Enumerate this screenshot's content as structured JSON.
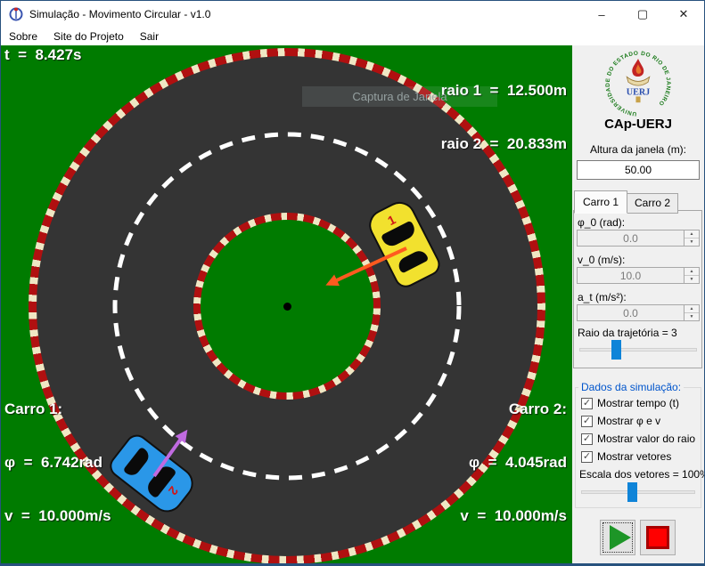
{
  "window": {
    "title": "Simulação - Movimento Circular - v1.0"
  },
  "icons": {
    "minimize": "–",
    "maximize": "▢",
    "close": "✕",
    "check": "✓",
    "spin_up": "▲",
    "spin_down": "▼"
  },
  "menu": {
    "items": [
      "Sobre",
      "Site do Projeto",
      "Sair"
    ]
  },
  "canvas": {
    "time": "t  =  8.427s",
    "radius1": "raio 1  =  12.500m",
    "radius2": "raio 2  =  20.833m",
    "capture_button": "Captura de Janela",
    "car1": {
      "title": "Carro 1:",
      "phi": "φ  =  6.742rad",
      "v": "v  =  10.000m/s",
      "number": "1"
    },
    "car2": {
      "title": "Carro 2:",
      "phi": "φ  =  4.045rad",
      "v": "v  =  10.000m/s",
      "number": "2"
    }
  },
  "sidebar": {
    "logo": {
      "ring_text": "UNIVERSIDADE DO ESTADO DO RIO DE JANEIRO",
      "acronym": "UERJ"
    },
    "title": "CAp-UERJ",
    "window_height": {
      "label": "Altura da janela (m):",
      "value": "50.00"
    },
    "tabs": [
      {
        "label": "Carro 1"
      },
      {
        "label": "Carro 2"
      }
    ],
    "fields": [
      {
        "label": "φ_0 (rad):",
        "value": "0.0"
      },
      {
        "label": "v_0 (m/s):",
        "value": "10.0"
      },
      {
        "label": "a_t (m/s²):",
        "value": "0.0"
      }
    ],
    "radius_slider": {
      "label": "Raio da trajetória = 3"
    },
    "group": {
      "label": "Dados da simulação:"
    },
    "checkboxes": [
      {
        "label": "Mostrar tempo (t)",
        "checked": true
      },
      {
        "label": "Mostrar φ e v",
        "checked": true
      },
      {
        "label": "Mostrar valor do raio",
        "checked": true
      },
      {
        "label": "Mostrar vetores",
        "checked": true
      }
    ],
    "scale_slider": {
      "label": "Escala dos vetores = 100%"
    }
  },
  "colors": {
    "grass": "#007b00",
    "track": "#343434",
    "curb_red": "#b01010",
    "curb_cream": "#efe7c4",
    "car1_body": "#f2e12e",
    "car2_body": "#2a97e8",
    "vector_car1": "#ff5a1f",
    "vector_car2": "#c06ae0",
    "slider_thumb": "#0f84d8",
    "group_label": "#0055cc",
    "window_border": "#28527e"
  }
}
